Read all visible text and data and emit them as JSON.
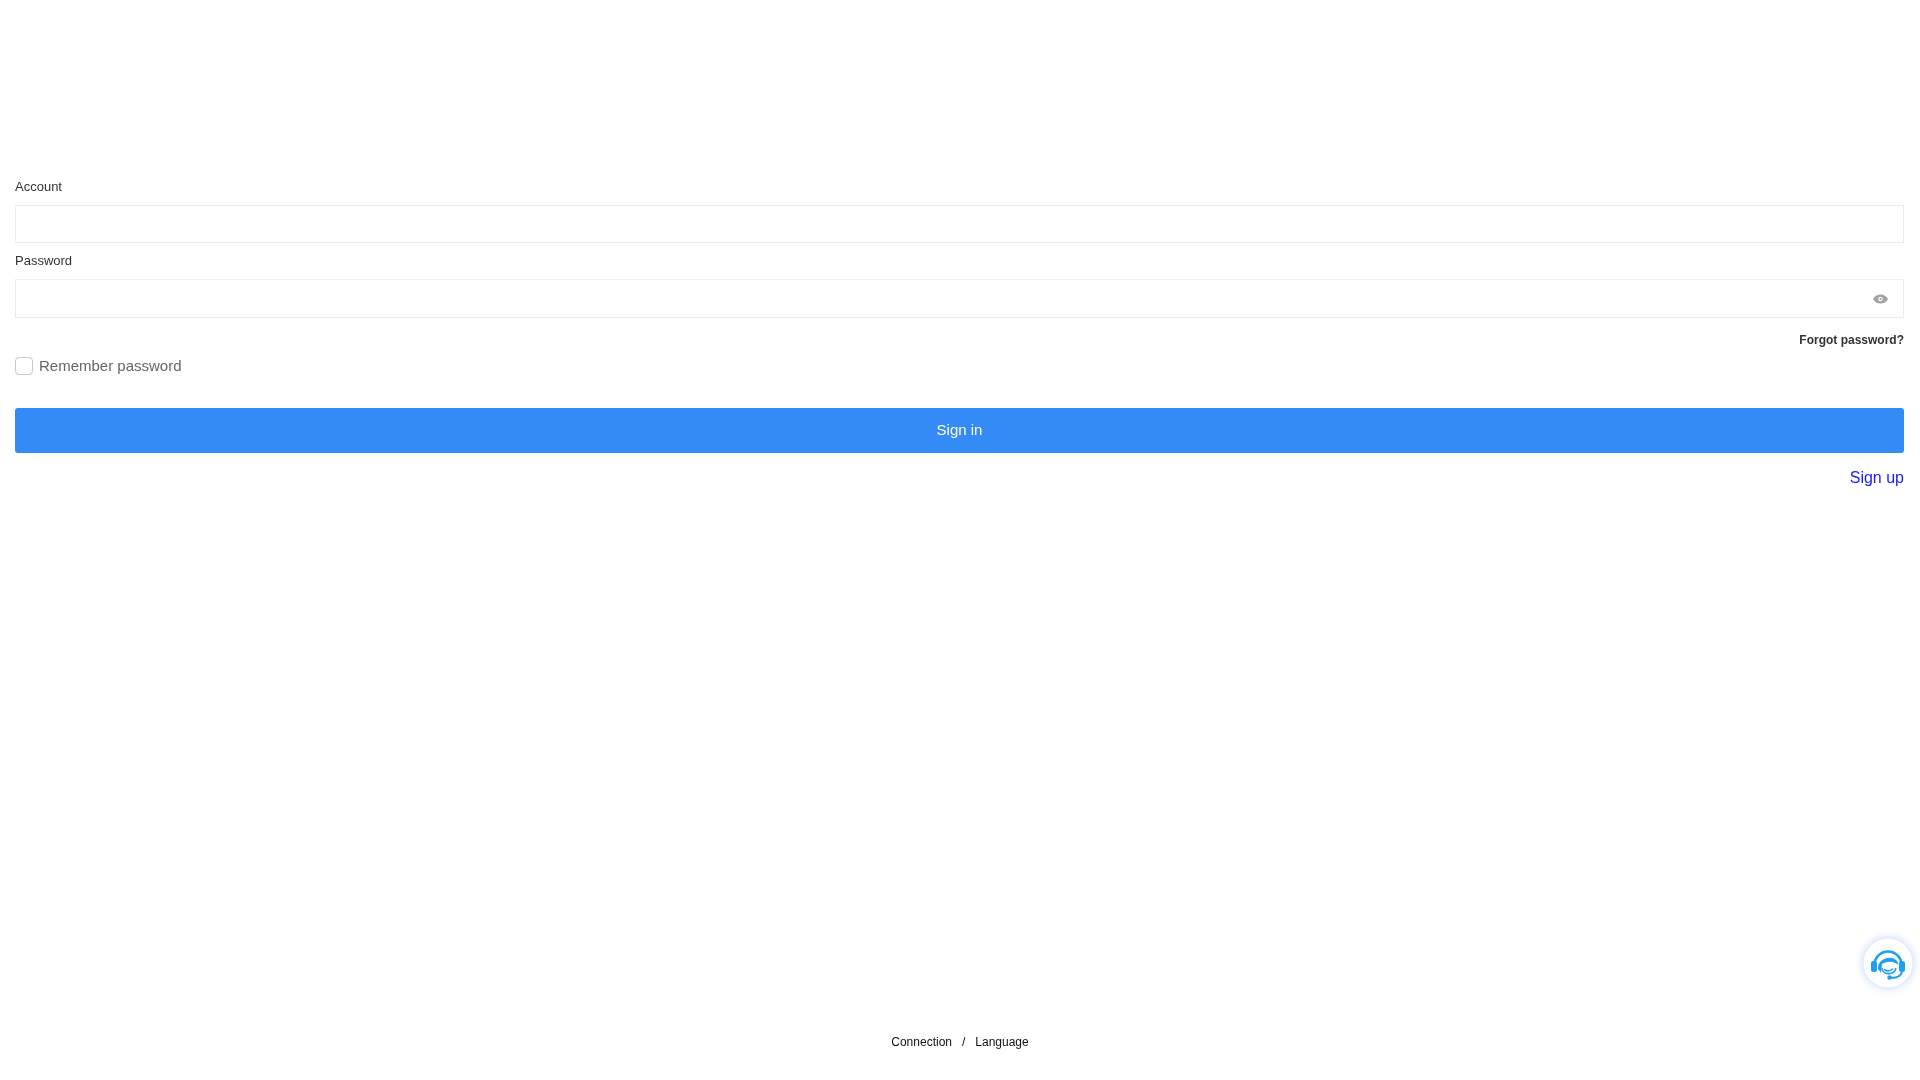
{
  "form": {
    "fields": [
      {
        "kind": "text",
        "label": "Account"
      },
      {
        "kind": "password",
        "label": "Password"
      }
    ],
    "forgot_link": "Forgot password?",
    "remember": {
      "label": "Remember password",
      "checked": false
    },
    "submit": "Sign in",
    "signup_link": "Sign up"
  },
  "footer": {
    "links": [
      "Connection",
      "Language"
    ],
    "separator": "/"
  }
}
